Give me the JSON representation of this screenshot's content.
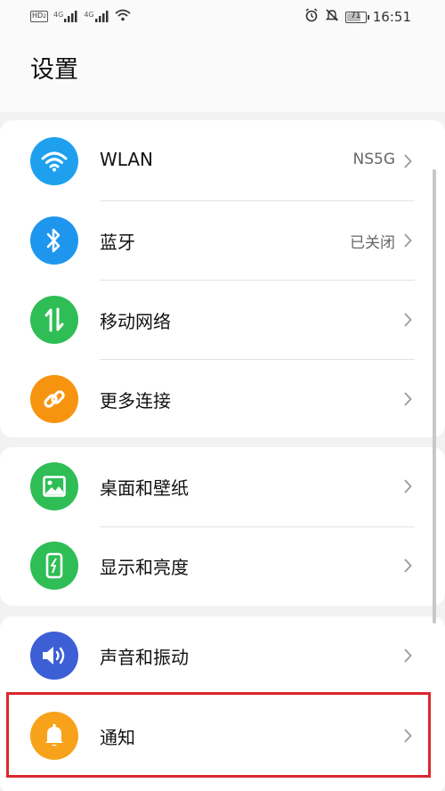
{
  "status_bar": {
    "hd_label": "HD",
    "hd_sub": "2",
    "signal1_label": "4G",
    "signal2_label": "4G",
    "battery": "71",
    "time": "16:51"
  },
  "header": {
    "title": "设置"
  },
  "colors": {
    "wlan": "#1ea0ef",
    "bluetooth": "#1e96ee",
    "mobile": "#2fbd55",
    "more": "#f7940f",
    "wallpaper": "#2fbd55",
    "display": "#2fbd55",
    "sound": "#3d5fd6",
    "notify": "#f7a21a",
    "highlight": "#d9272e"
  },
  "items": [
    {
      "label": "WLAN",
      "value": "NS5G",
      "icon": "wifi-icon"
    },
    {
      "label": "蓝牙",
      "value": "已关闭",
      "icon": "bluetooth-icon"
    },
    {
      "label": "移动网络",
      "value": "",
      "icon": "mobile-data-icon"
    },
    {
      "label": "更多连接",
      "value": "",
      "icon": "link-icon"
    },
    {
      "label": "桌面和壁纸",
      "value": "",
      "icon": "image-icon"
    },
    {
      "label": "显示和亮度",
      "value": "",
      "icon": "brightness-icon"
    },
    {
      "label": "声音和振动",
      "value": "",
      "icon": "speaker-icon"
    },
    {
      "label": "通知",
      "value": "",
      "icon": "bell-icon"
    }
  ]
}
